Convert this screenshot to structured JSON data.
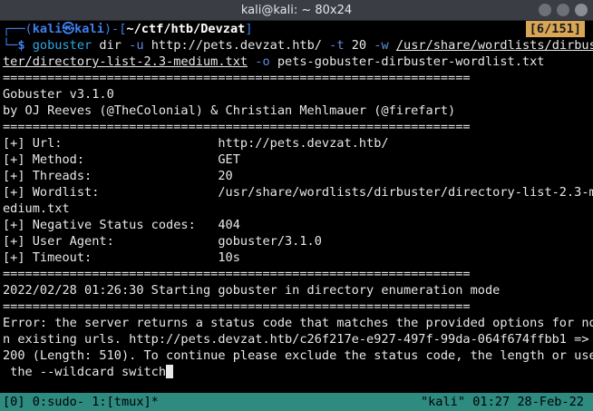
{
  "window": {
    "title": "kali@kali: ~ 80x24"
  },
  "prompt": {
    "open": "┌──(",
    "user": "kali㉿kali",
    "close": ")-[",
    "cwd": "~/ctf/htb/Devzat",
    "end": "]",
    "corner": "└─",
    "dollar": "$ ",
    "scroll_counter": "[6/151]"
  },
  "command": {
    "name": "gobuster",
    "arg1": " dir ",
    "flag_u": "-u",
    "url": " http://pets.devzat.htb/ ",
    "flag_t": "-t",
    "threads": " 20 ",
    "flag_w": "-w",
    "wordlist_part1": "/usr/share/wordlists/dirbus",
    "wordlist_part2": "ter/directory-list-2.3-medium.txt",
    "flag_o": "-o",
    "outfile": " pets-gobuster-dirbuster-wordlist.txt"
  },
  "output": {
    "separator": "===============================================================",
    "version": "Gobuster v3.1.0",
    "authors": "by OJ Reeves (@TheColonial) & Christian Mehlmauer (@firefart)",
    "config": [
      "[+] Url:                     http://pets.devzat.htb/",
      "[+] Method:                  GET",
      "[+] Threads:                 20",
      "[+] Wordlist:                /usr/share/wordlists/dirbuster/directory-list-2.3-m",
      "edium.txt",
      "[+] Negative Status codes:   404",
      "[+] User Agent:              gobuster/3.1.0",
      "[+] Timeout:                 10s"
    ],
    "start_message": "2022/02/28 01:26:30 Starting gobuster in directory enumeration mode",
    "error_lines": [
      "Error: the server returns a status code that matches the provided options for no",
      "n existing urls. http://pets.devzat.htb/c26f217e-e927-497f-99da-064f674ffbb1 =>",
      "200 (Length: 510). To continue please exclude the status code, the length or use",
      " the --wildcard switch"
    ]
  },
  "tmux": {
    "left": "[0] 0:sudo- 1:[tmux]*",
    "right": "\"kali\" 01:27 28-Feb-22"
  },
  "colors": {
    "prompt_blue": "#3f7ff0",
    "cwd_white": "#ffffff",
    "counter_bg": "#d8a657",
    "tmux_bar": "#2e8b80"
  }
}
